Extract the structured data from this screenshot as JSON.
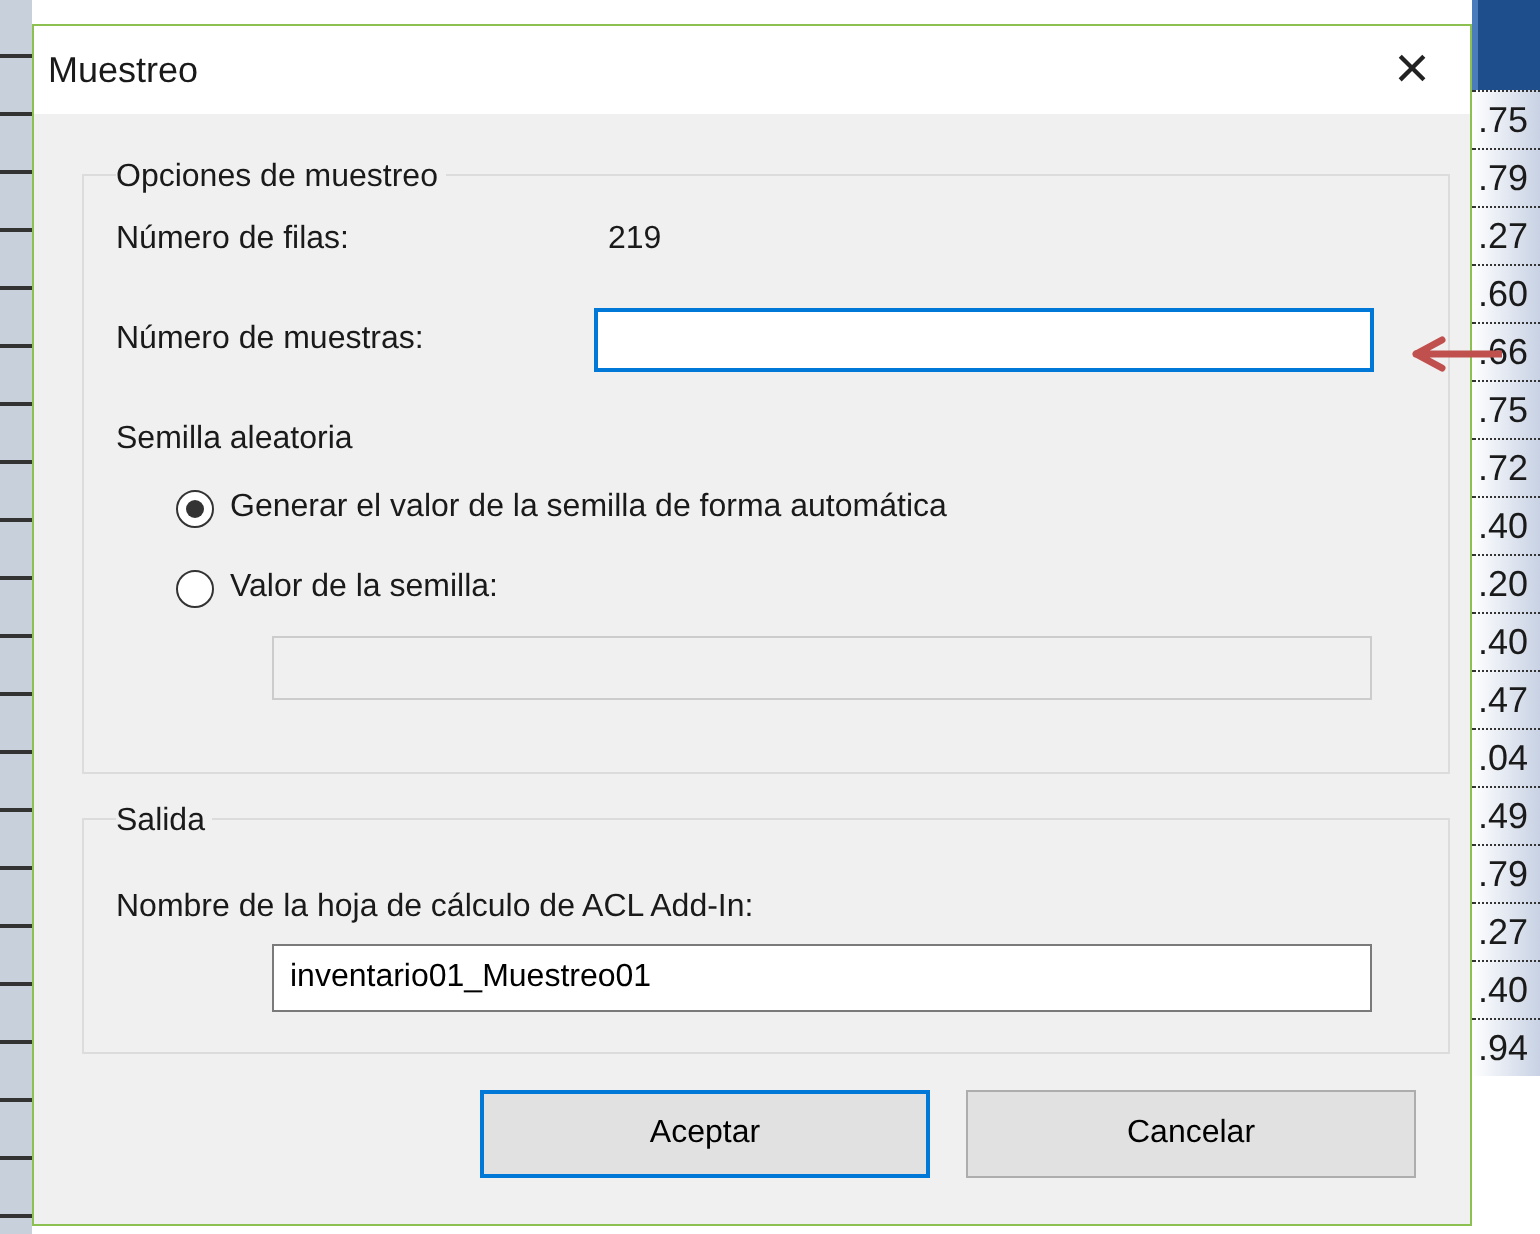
{
  "window": {
    "title": "Muestreo",
    "close": "×"
  },
  "sampling_options": {
    "legend": "Opciones de muestreo",
    "rows_label": "Número de filas:",
    "rows_value": "219",
    "samples_label": "Número de muestras:"
  },
  "random_seed": {
    "label": "Semilla aleatoria",
    "options": [
      {
        "label": "Generar el valor de la semilla de forma automática",
        "selected": true
      },
      {
        "label": "Valor de la semilla:",
        "selected": false
      }
    ],
    "seed_field": {
      "disabled": true
    }
  },
  "output": {
    "legend": "Salida",
    "label": "Nombre de la hoja de cálculo de ACL Add-In:",
    "value": "inventario01_Muestreo01"
  },
  "buttons": [
    {
      "label": "Aceptar",
      "default": true
    },
    {
      "label": "Cancelar",
      "default": false
    }
  ],
  "background_column": [
    ".75",
    ".79",
    ".27",
    ".60",
    ".66",
    ".75",
    ".72",
    ".40",
    ".20",
    ".40",
    ".47",
    ".04",
    ".49",
    ".79",
    ".27",
    ".40",
    ".94"
  ]
}
